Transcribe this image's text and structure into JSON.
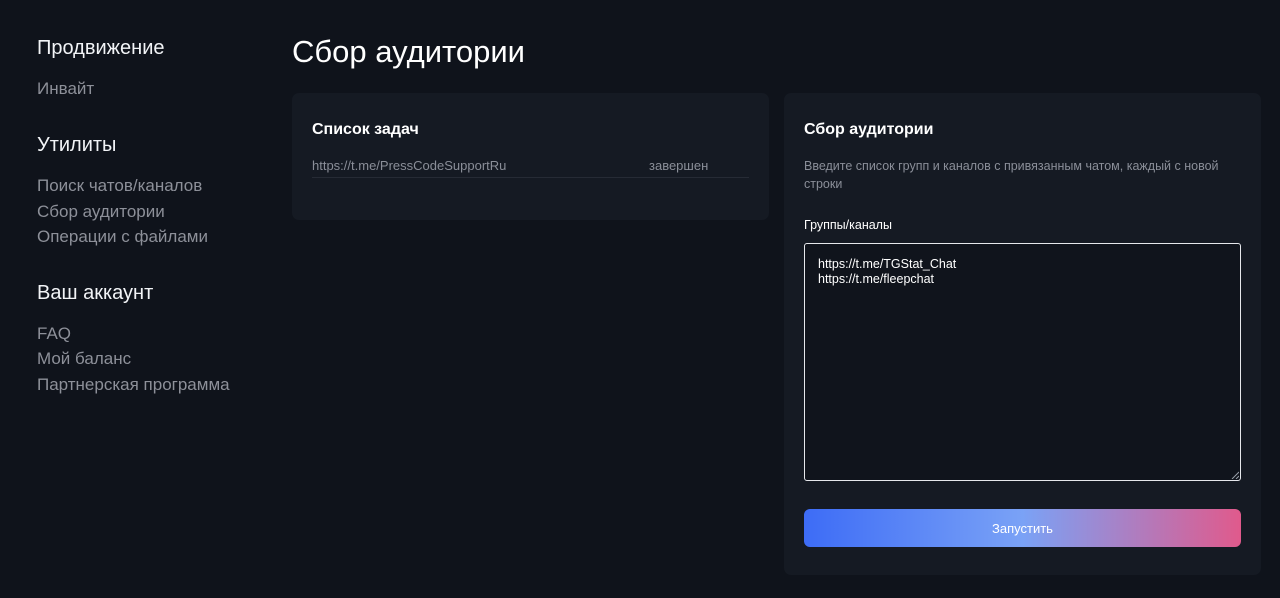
{
  "sidebar": {
    "groups": [
      {
        "title": "Продвижение",
        "items": [
          "Инвайт"
        ]
      },
      {
        "title": "Утилиты",
        "items": [
          "Поиск чатов/каналов",
          "Сбор аудитории",
          "Операции с файлами"
        ]
      },
      {
        "title": "Ваш аккаунт",
        "items": [
          "FAQ",
          "Мой баланс",
          "Партнерская программа"
        ]
      }
    ]
  },
  "main": {
    "title": "Сбор аудитории",
    "task_list": {
      "title": "Список задач",
      "rows": [
        {
          "url": "https://t.me/PressCodeSupportRu",
          "status": "завершен"
        }
      ]
    },
    "form": {
      "title": "Сбор аудитории",
      "description": "Введите список групп и каналов с привязанным чатом, каждый с новой строки",
      "field_label": "Группы/каналы",
      "field_lines": [
        "https://t.me/TGStat_Chat",
        "https://t.me/fleepchat"
      ],
      "submit_label": "Запустить"
    }
  },
  "colors": {
    "background": "#0f131b",
    "card": "#151a23",
    "muted_text": "#8a8e98",
    "button_gradient_start": "#3d6cf6",
    "button_gradient_end": "#e05a8c"
  }
}
